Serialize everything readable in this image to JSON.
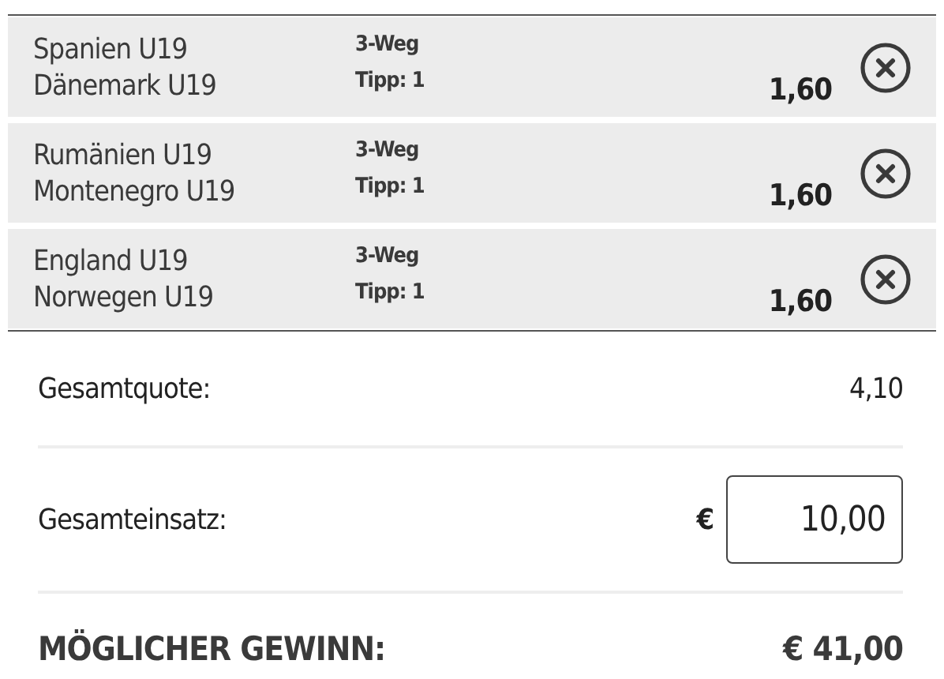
{
  "selections": [
    {
      "home": "Spanien U19",
      "away": "Dänemark U19",
      "market": "3-Weg",
      "tip": "Tipp: 1",
      "odds": "1,60"
    },
    {
      "home": "Rumänien U19",
      "away": "Montenegro U19",
      "market": "3-Weg",
      "tip": "Tipp: 1",
      "odds": "1,60"
    },
    {
      "home": "England U19",
      "away": "Norwegen U19",
      "market": "3-Weg",
      "tip": "Tipp: 1",
      "odds": "1,60"
    }
  ],
  "total_odds": {
    "label": "Gesamtquote:",
    "value": "4,10"
  },
  "stake": {
    "label": "Gesamteinsatz:",
    "currency": "€",
    "value": "10,00"
  },
  "potential_win": {
    "label": "MÖGLICHER GEWINN:",
    "value": "€ 41,00"
  }
}
